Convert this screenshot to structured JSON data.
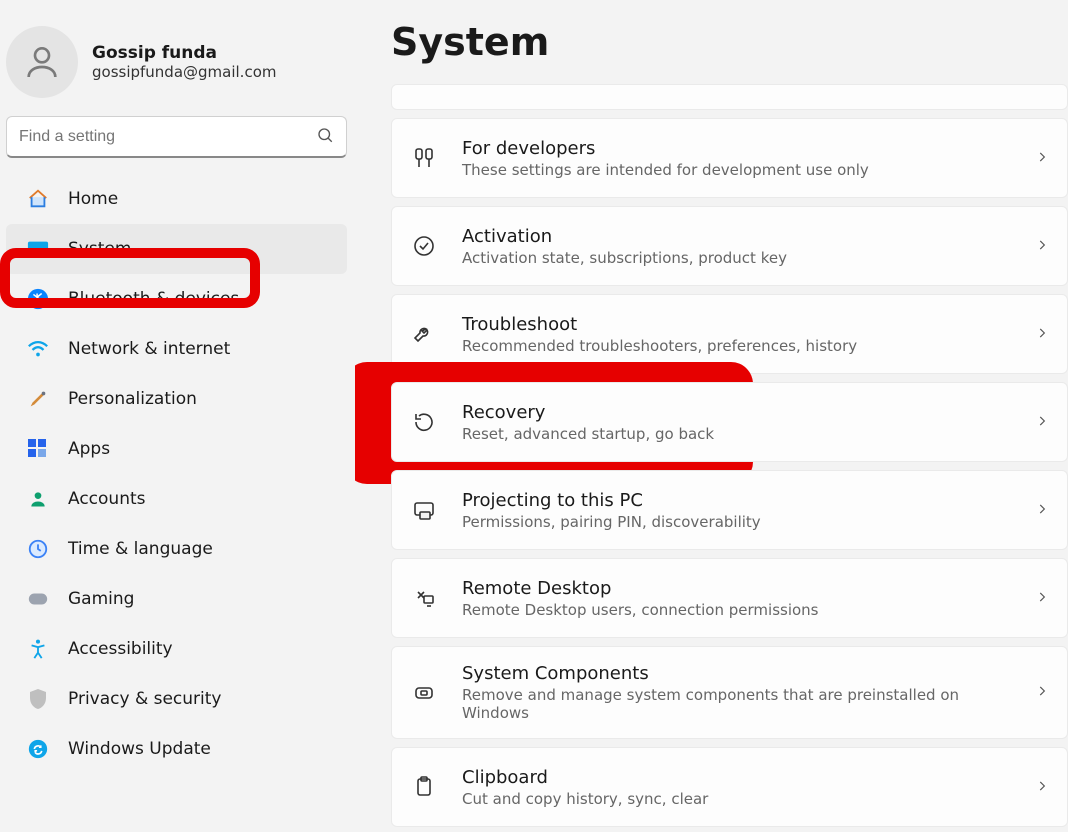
{
  "user": {
    "name": "Gossip funda",
    "email": "gossipfunda@gmail.com"
  },
  "search": {
    "placeholder": "Find a setting"
  },
  "nav": [
    {
      "label": "Home"
    },
    {
      "label": "System"
    },
    {
      "label": "Bluetooth & devices"
    },
    {
      "label": "Network & internet"
    },
    {
      "label": "Personalization"
    },
    {
      "label": "Apps"
    },
    {
      "label": "Accounts"
    },
    {
      "label": "Time & language"
    },
    {
      "label": "Gaming"
    },
    {
      "label": "Accessibility"
    },
    {
      "label": "Privacy & security"
    },
    {
      "label": "Windows Update"
    }
  ],
  "page": {
    "title": "System"
  },
  "items": [
    {
      "title": "For developers",
      "sub": "These settings are intended for development use only"
    },
    {
      "title": "Activation",
      "sub": "Activation state, subscriptions, product key"
    },
    {
      "title": "Troubleshoot",
      "sub": "Recommended troubleshooters, preferences, history"
    },
    {
      "title": "Recovery",
      "sub": "Reset, advanced startup, go back"
    },
    {
      "title": "Projecting to this PC",
      "sub": "Permissions, pairing PIN, discoverability"
    },
    {
      "title": "Remote Desktop",
      "sub": "Remote Desktop users, connection permissions"
    },
    {
      "title": "System Components",
      "sub": "Remove and manage system components that are preinstalled on Windows"
    },
    {
      "title": "Clipboard",
      "sub": "Cut and copy history, sync, clear"
    }
  ]
}
